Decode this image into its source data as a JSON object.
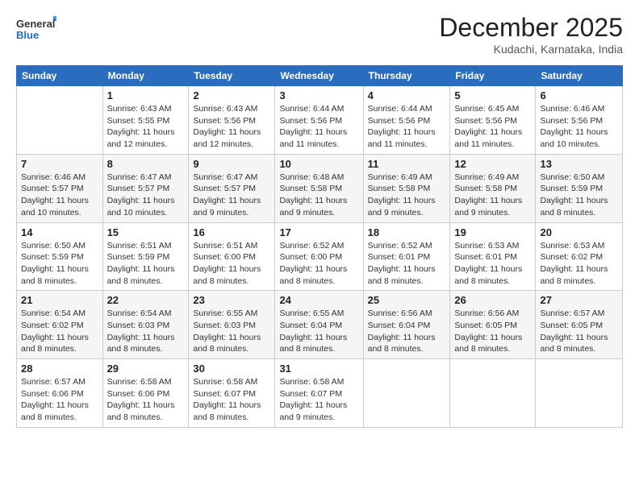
{
  "header": {
    "logo_general": "General",
    "logo_blue": "Blue",
    "month_title": "December 2025",
    "location": "Kudachi, Karnataka, India"
  },
  "weekdays": [
    "Sunday",
    "Monday",
    "Tuesday",
    "Wednesday",
    "Thursday",
    "Friday",
    "Saturday"
  ],
  "weeks": [
    [
      {
        "day": "",
        "sunrise": "",
        "sunset": "",
        "daylight": ""
      },
      {
        "day": "1",
        "sunrise": "Sunrise: 6:43 AM",
        "sunset": "Sunset: 5:55 PM",
        "daylight": "Daylight: 11 hours and 12 minutes."
      },
      {
        "day": "2",
        "sunrise": "Sunrise: 6:43 AM",
        "sunset": "Sunset: 5:56 PM",
        "daylight": "Daylight: 11 hours and 12 minutes."
      },
      {
        "day": "3",
        "sunrise": "Sunrise: 6:44 AM",
        "sunset": "Sunset: 5:56 PM",
        "daylight": "Daylight: 11 hours and 11 minutes."
      },
      {
        "day": "4",
        "sunrise": "Sunrise: 6:44 AM",
        "sunset": "Sunset: 5:56 PM",
        "daylight": "Daylight: 11 hours and 11 minutes."
      },
      {
        "day": "5",
        "sunrise": "Sunrise: 6:45 AM",
        "sunset": "Sunset: 5:56 PM",
        "daylight": "Daylight: 11 hours and 11 minutes."
      },
      {
        "day": "6",
        "sunrise": "Sunrise: 6:46 AM",
        "sunset": "Sunset: 5:56 PM",
        "daylight": "Daylight: 11 hours and 10 minutes."
      }
    ],
    [
      {
        "day": "7",
        "sunrise": "Sunrise: 6:46 AM",
        "sunset": "Sunset: 5:57 PM",
        "daylight": "Daylight: 11 hours and 10 minutes."
      },
      {
        "day": "8",
        "sunrise": "Sunrise: 6:47 AM",
        "sunset": "Sunset: 5:57 PM",
        "daylight": "Daylight: 11 hours and 10 minutes."
      },
      {
        "day": "9",
        "sunrise": "Sunrise: 6:47 AM",
        "sunset": "Sunset: 5:57 PM",
        "daylight": "Daylight: 11 hours and 9 minutes."
      },
      {
        "day": "10",
        "sunrise": "Sunrise: 6:48 AM",
        "sunset": "Sunset: 5:58 PM",
        "daylight": "Daylight: 11 hours and 9 minutes."
      },
      {
        "day": "11",
        "sunrise": "Sunrise: 6:49 AM",
        "sunset": "Sunset: 5:58 PM",
        "daylight": "Daylight: 11 hours and 9 minutes."
      },
      {
        "day": "12",
        "sunrise": "Sunrise: 6:49 AM",
        "sunset": "Sunset: 5:58 PM",
        "daylight": "Daylight: 11 hours and 9 minutes."
      },
      {
        "day": "13",
        "sunrise": "Sunrise: 6:50 AM",
        "sunset": "Sunset: 5:59 PM",
        "daylight": "Daylight: 11 hours and 8 minutes."
      }
    ],
    [
      {
        "day": "14",
        "sunrise": "Sunrise: 6:50 AM",
        "sunset": "Sunset: 5:59 PM",
        "daylight": "Daylight: 11 hours and 8 minutes."
      },
      {
        "day": "15",
        "sunrise": "Sunrise: 6:51 AM",
        "sunset": "Sunset: 5:59 PM",
        "daylight": "Daylight: 11 hours and 8 minutes."
      },
      {
        "day": "16",
        "sunrise": "Sunrise: 6:51 AM",
        "sunset": "Sunset: 6:00 PM",
        "daylight": "Daylight: 11 hours and 8 minutes."
      },
      {
        "day": "17",
        "sunrise": "Sunrise: 6:52 AM",
        "sunset": "Sunset: 6:00 PM",
        "daylight": "Daylight: 11 hours and 8 minutes."
      },
      {
        "day": "18",
        "sunrise": "Sunrise: 6:52 AM",
        "sunset": "Sunset: 6:01 PM",
        "daylight": "Daylight: 11 hours and 8 minutes."
      },
      {
        "day": "19",
        "sunrise": "Sunrise: 6:53 AM",
        "sunset": "Sunset: 6:01 PM",
        "daylight": "Daylight: 11 hours and 8 minutes."
      },
      {
        "day": "20",
        "sunrise": "Sunrise: 6:53 AM",
        "sunset": "Sunset: 6:02 PM",
        "daylight": "Daylight: 11 hours and 8 minutes."
      }
    ],
    [
      {
        "day": "21",
        "sunrise": "Sunrise: 6:54 AM",
        "sunset": "Sunset: 6:02 PM",
        "daylight": "Daylight: 11 hours and 8 minutes."
      },
      {
        "day": "22",
        "sunrise": "Sunrise: 6:54 AM",
        "sunset": "Sunset: 6:03 PM",
        "daylight": "Daylight: 11 hours and 8 minutes."
      },
      {
        "day": "23",
        "sunrise": "Sunrise: 6:55 AM",
        "sunset": "Sunset: 6:03 PM",
        "daylight": "Daylight: 11 hours and 8 minutes."
      },
      {
        "day": "24",
        "sunrise": "Sunrise: 6:55 AM",
        "sunset": "Sunset: 6:04 PM",
        "daylight": "Daylight: 11 hours and 8 minutes."
      },
      {
        "day": "25",
        "sunrise": "Sunrise: 6:56 AM",
        "sunset": "Sunset: 6:04 PM",
        "daylight": "Daylight: 11 hours and 8 minutes."
      },
      {
        "day": "26",
        "sunrise": "Sunrise: 6:56 AM",
        "sunset": "Sunset: 6:05 PM",
        "daylight": "Daylight: 11 hours and 8 minutes."
      },
      {
        "day": "27",
        "sunrise": "Sunrise: 6:57 AM",
        "sunset": "Sunset: 6:05 PM",
        "daylight": "Daylight: 11 hours and 8 minutes."
      }
    ],
    [
      {
        "day": "28",
        "sunrise": "Sunrise: 6:57 AM",
        "sunset": "Sunset: 6:06 PM",
        "daylight": "Daylight: 11 hours and 8 minutes."
      },
      {
        "day": "29",
        "sunrise": "Sunrise: 6:58 AM",
        "sunset": "Sunset: 6:06 PM",
        "daylight": "Daylight: 11 hours and 8 minutes."
      },
      {
        "day": "30",
        "sunrise": "Sunrise: 6:58 AM",
        "sunset": "Sunset: 6:07 PM",
        "daylight": "Daylight: 11 hours and 8 minutes."
      },
      {
        "day": "31",
        "sunrise": "Sunrise: 6:58 AM",
        "sunset": "Sunset: 6:07 PM",
        "daylight": "Daylight: 11 hours and 9 minutes."
      },
      {
        "day": "",
        "sunrise": "",
        "sunset": "",
        "daylight": ""
      },
      {
        "day": "",
        "sunrise": "",
        "sunset": "",
        "daylight": ""
      },
      {
        "day": "",
        "sunrise": "",
        "sunset": "",
        "daylight": ""
      }
    ]
  ]
}
